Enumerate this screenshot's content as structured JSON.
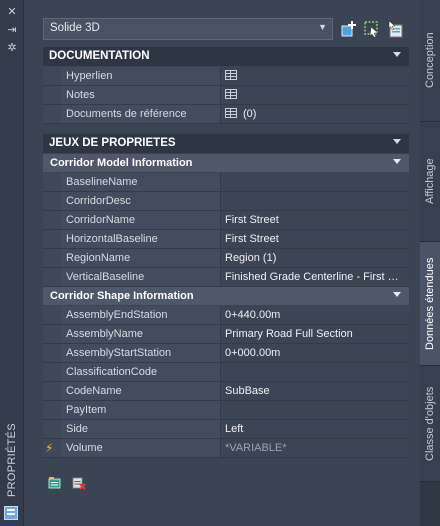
{
  "left_strip": {
    "title": "PROPRIÉTÉS"
  },
  "selector": {
    "value": "Solide 3D"
  },
  "sections": {
    "documentation": {
      "title": "DOCUMENTATION",
      "rows": [
        {
          "name": "Hyperlien",
          "value": ""
        },
        {
          "name": "Notes",
          "value": ""
        },
        {
          "name": "Documents de référence",
          "value": "(0)"
        }
      ]
    },
    "property_sets": {
      "title": "JEUX DE PROPRIETES"
    },
    "corridor_model": {
      "title": "Corridor Model Information",
      "rows": [
        {
          "name": "BaselineName",
          "value": ""
        },
        {
          "name": "CorridorDesc",
          "value": ""
        },
        {
          "name": "CorridorName",
          "value": "First Street"
        },
        {
          "name": "HorizontalBaseline",
          "value": "First Street"
        },
        {
          "name": "RegionName",
          "value": "Region (1)"
        },
        {
          "name": "VerticalBaseline",
          "value": "Finished Grade Centerline - First Street"
        }
      ]
    },
    "corridor_shape": {
      "title": "Corridor Shape Information",
      "rows": [
        {
          "name": "AssemblyEndStation",
          "value": "0+440.00m"
        },
        {
          "name": "AssemblyName",
          "value": "Primary Road Full Section"
        },
        {
          "name": "AssemblyStartStation",
          "value": "0+000.00m"
        },
        {
          "name": "ClassificationCode",
          "value": ""
        },
        {
          "name": "CodeName",
          "value": "SubBase"
        },
        {
          "name": "PayItem",
          "value": ""
        },
        {
          "name": "Side",
          "value": "Left"
        },
        {
          "name": "Volume",
          "value": "*VARIABLE*"
        }
      ]
    }
  },
  "right_tabs": {
    "conception": "Conception",
    "affichage": "Affichage",
    "donnees": "Données étendues",
    "classe": "Classe d'objets"
  },
  "colors": {
    "background": "#3b4453",
    "header": "#2e3643",
    "accent_icon": "#4fc3f7"
  }
}
